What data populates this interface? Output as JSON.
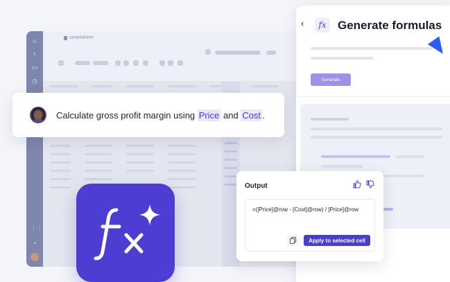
{
  "app": {
    "brand": "smartsheet"
  },
  "panel": {
    "title": "Generate formulas",
    "generate_label": "Generate"
  },
  "prompt": {
    "text_before": "Calculate gross profit margin using ",
    "column_a": "Price",
    "text_between": " and ",
    "column_b": "Cost",
    "text_after": "."
  },
  "output": {
    "label": "Output",
    "formula": "=([Price]@row - [Cost]@row) / [Price]@row",
    "apply_label": "Apply to selected cell"
  },
  "colors": {
    "accent": "#4b3fc9",
    "cursor": "#2a5cf6",
    "chip_bg": "#e9e7fb"
  },
  "icons": [
    "back-chevron-icon",
    "fx-icon",
    "thumbs-up-icon",
    "thumbs-down-icon",
    "copy-icon",
    "sparkle-icon"
  ]
}
